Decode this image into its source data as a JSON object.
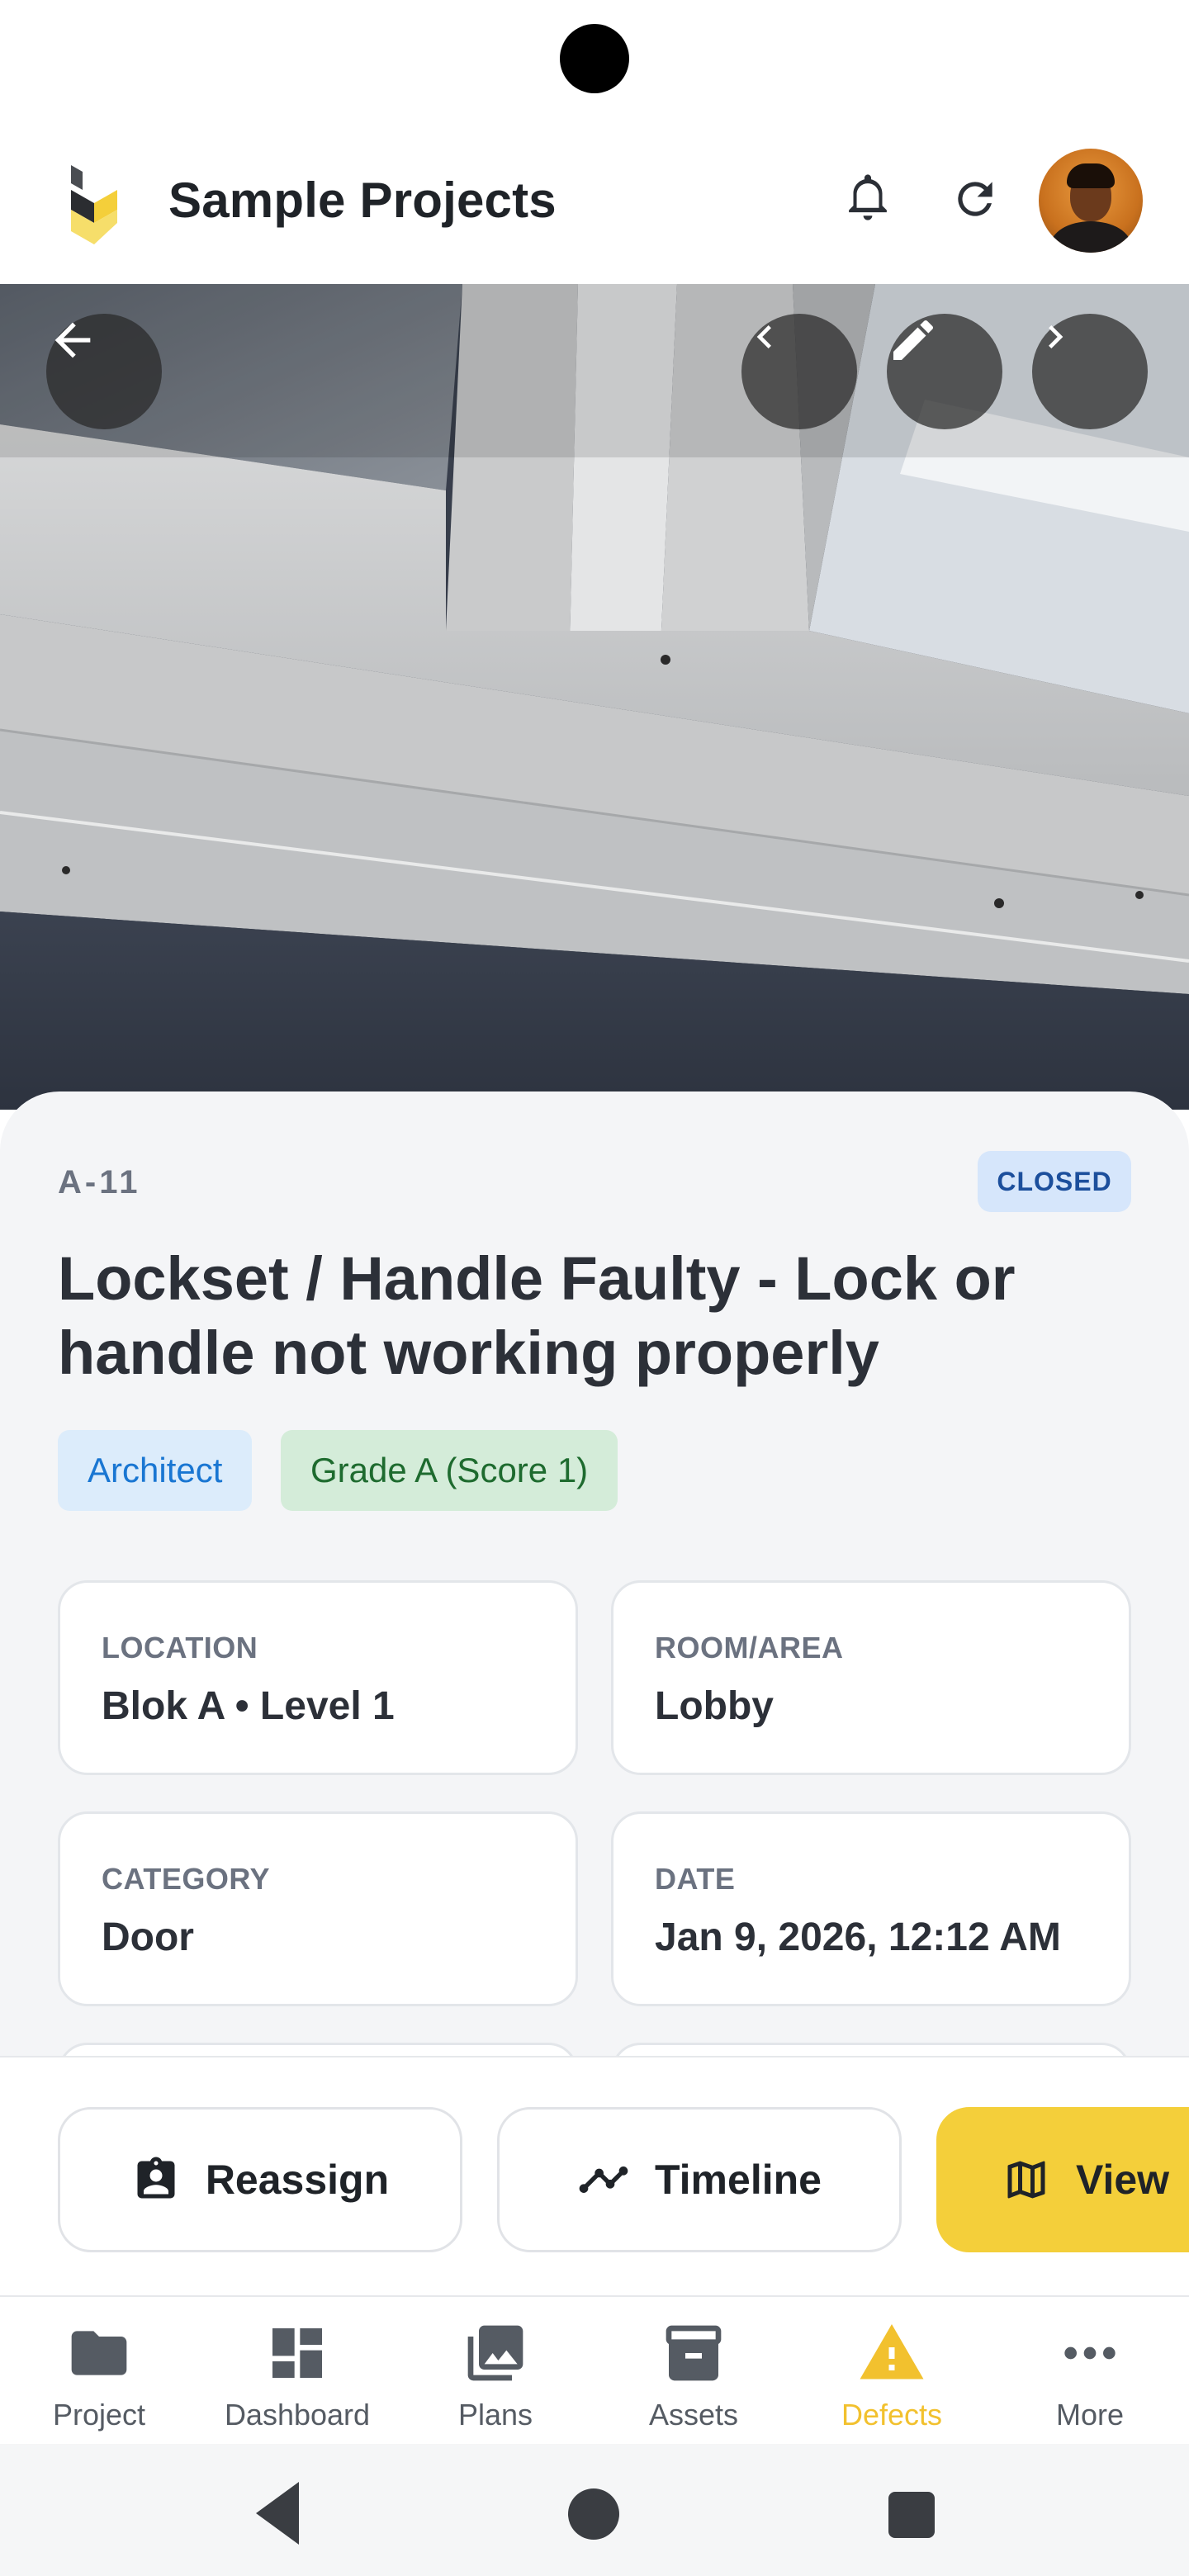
{
  "app": {
    "title": "Sample Projects"
  },
  "defect": {
    "id": "A-11",
    "status": "CLOSED",
    "title": "Lockset / Handle Faulty - Lock or handle not working properly",
    "tags": [
      "Architect",
      "Grade A (Score 1)"
    ],
    "details": [
      {
        "label": "LOCATION",
        "value": "Blok A • Level 1"
      },
      {
        "label": "ROOM/AREA",
        "value": "Lobby"
      },
      {
        "label": "CATEGORY",
        "value": "Door"
      },
      {
        "label": "DATE",
        "value": "Jan 9, 2026, 12:12 AM"
      }
    ]
  },
  "actions": {
    "reassign": "Reassign",
    "timeline": "Timeline",
    "view": "View"
  },
  "nav": {
    "items": [
      {
        "label": "Project",
        "icon": "folder-icon"
      },
      {
        "label": "Dashboard",
        "icon": "dashboard-icon"
      },
      {
        "label": "Plans",
        "icon": "images-icon"
      },
      {
        "label": "Assets",
        "icon": "archive-box-icon"
      },
      {
        "label": "Defects",
        "icon": "warning-triangle-icon",
        "active": true
      },
      {
        "label": "More",
        "icon": "more-dots-icon"
      }
    ]
  },
  "colors": {
    "accent": "#f4cf3a",
    "status_badge_bg": "#d6e6fb",
    "status_badge_text": "#1c4f9c",
    "tag_architect_bg": "#dcecfb",
    "tag_architect_text": "#1976d2",
    "tag_grade_bg": "#d4ecd9",
    "tag_grade_text": "#1e6b2f"
  }
}
